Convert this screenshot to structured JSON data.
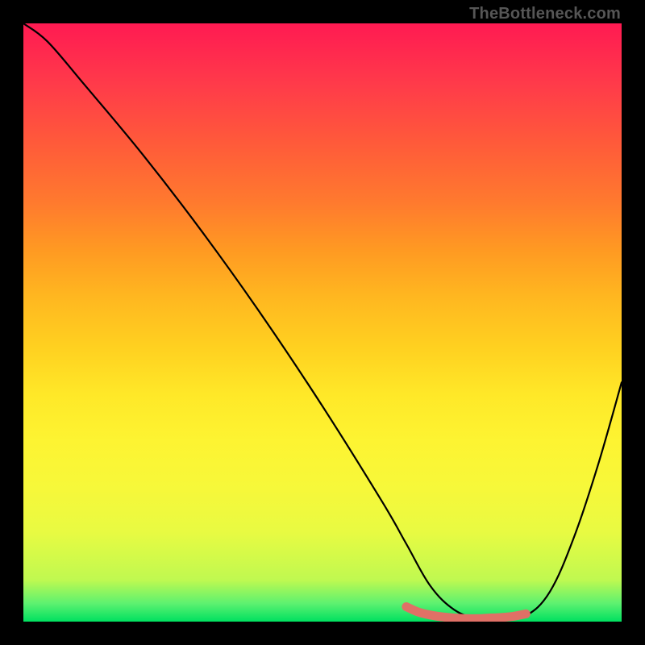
{
  "watermark": "TheBottleneck.com",
  "chart_data": {
    "type": "line",
    "title": "",
    "xlabel": "",
    "ylabel": "",
    "xlim": [
      0,
      100
    ],
    "ylim": [
      0,
      100
    ],
    "grid": false,
    "series": [
      {
        "name": "curve",
        "color": "#000000",
        "x": [
          0,
          4,
          10,
          20,
          30,
          40,
          50,
          60,
          64,
          68,
          72,
          76,
          80,
          84,
          88,
          92,
          96,
          100
        ],
        "values": [
          100,
          97,
          90,
          78,
          65,
          51,
          36,
          20,
          13,
          6,
          2,
          0.5,
          0.5,
          1,
          5,
          14,
          26,
          40
        ]
      },
      {
        "name": "highlight",
        "color": "#e07066",
        "x": [
          64,
          66,
          68,
          70,
          72,
          74,
          76,
          78,
          80,
          82,
          84
        ],
        "values": [
          2.5,
          1.6,
          1.1,
          0.8,
          0.6,
          0.5,
          0.5,
          0.6,
          0.7,
          0.9,
          1.3
        ]
      }
    ],
    "gradient_stops": [
      {
        "pos": 0,
        "color": "#ff1a52"
      },
      {
        "pos": 10,
        "color": "#ff3a4a"
      },
      {
        "pos": 20,
        "color": "#ff5a3a"
      },
      {
        "pos": 30,
        "color": "#ff7a2e"
      },
      {
        "pos": 38,
        "color": "#ff9a22"
      },
      {
        "pos": 46,
        "color": "#ffb820"
      },
      {
        "pos": 54,
        "color": "#ffd020"
      },
      {
        "pos": 62,
        "color": "#ffe828"
      },
      {
        "pos": 70,
        "color": "#fdf432"
      },
      {
        "pos": 78,
        "color": "#f6f83a"
      },
      {
        "pos": 85,
        "color": "#e8fa42"
      },
      {
        "pos": 93,
        "color": "#c0f950"
      },
      {
        "pos": 97,
        "color": "#5cf170"
      },
      {
        "pos": 100,
        "color": "#00e060"
      }
    ]
  }
}
